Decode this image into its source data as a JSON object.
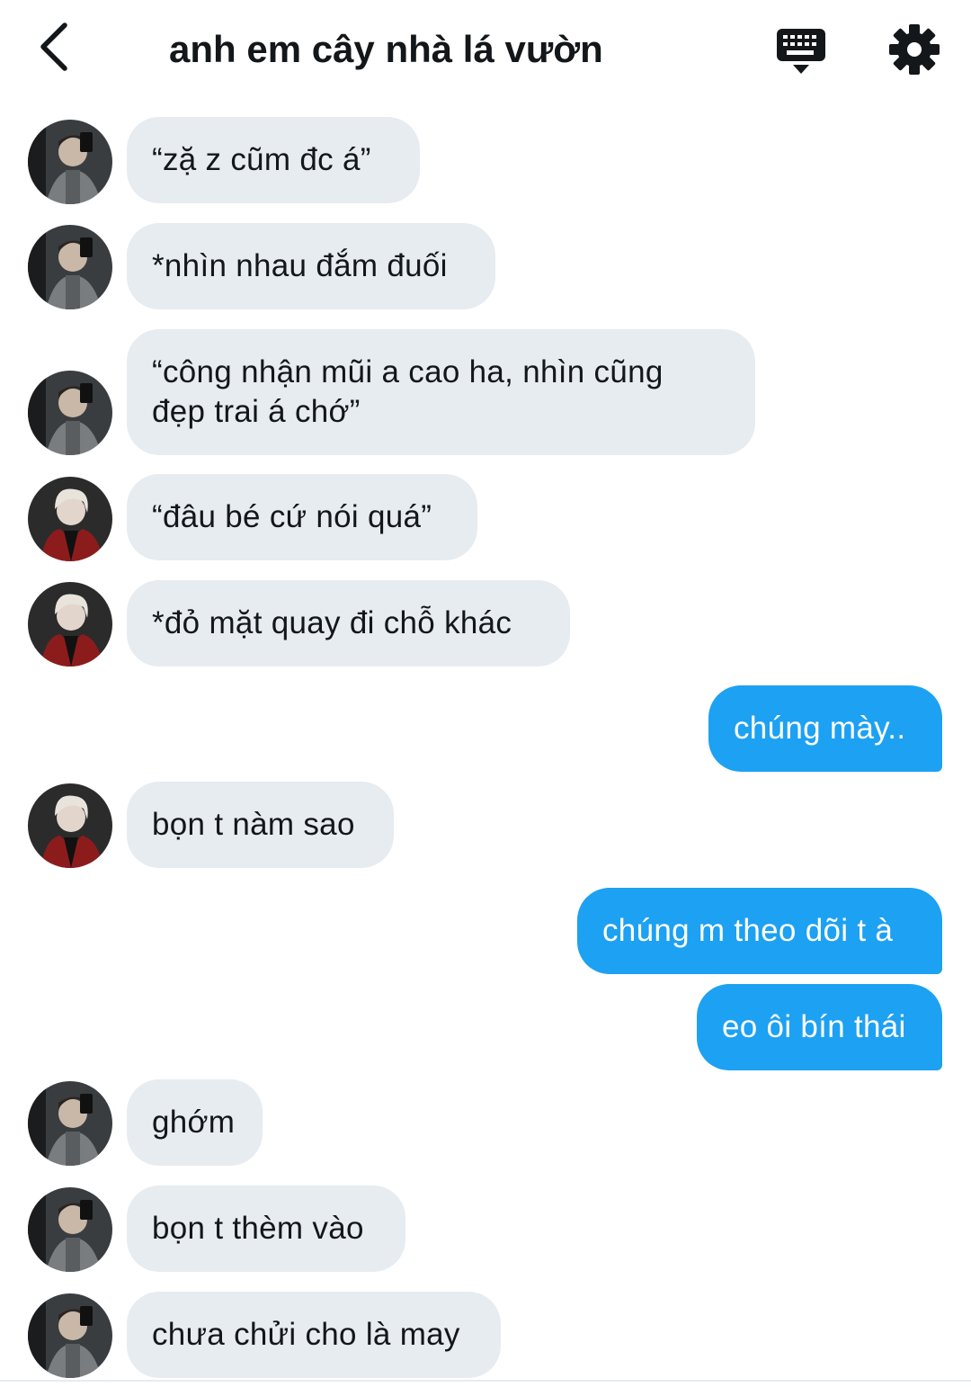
{
  "header": {
    "title": "anh em cây nhà lá vườn",
    "back_icon": "chevron-left-icon",
    "keyboard_icon": "keyboard-icon",
    "settings_icon": "gear-icon"
  },
  "colors": {
    "incoming_bubble": "#e6ecf0",
    "outgoing_bubble": "#1da1f2",
    "text": "#14171a"
  },
  "messages": [
    {
      "sender": "avatar-a",
      "direction": "in",
      "text": "“zặ z cũm đc á”"
    },
    {
      "sender": "avatar-a",
      "direction": "in",
      "text": "*nhìn nhau đắm đuối"
    },
    {
      "sender": "avatar-a",
      "direction": "in",
      "text": "“công nhận mũi a cao ha, nhìn cũng\nđẹp trai á chớ”"
    },
    {
      "sender": "avatar-b",
      "direction": "in",
      "text": "“đâu bé cứ nói quá”"
    },
    {
      "sender": "avatar-b",
      "direction": "in",
      "text": "*đỏ mặt quay đi chỗ khác"
    },
    {
      "sender": "me",
      "direction": "out",
      "text": "chúng mày.."
    },
    {
      "sender": "avatar-b",
      "direction": "in",
      "text": "bọn t nàm sao"
    },
    {
      "sender": "me",
      "direction": "out",
      "text": "chúng m theo dõi t à"
    },
    {
      "sender": "me",
      "direction": "out",
      "text": "eo ôi bín thái"
    },
    {
      "sender": "avatar-a",
      "direction": "in",
      "text": "ghớm"
    },
    {
      "sender": "avatar-a",
      "direction": "in",
      "text": "bọn t thèm vào"
    },
    {
      "sender": "avatar-a",
      "direction": "in",
      "text": "chưa chửi cho là may"
    }
  ]
}
